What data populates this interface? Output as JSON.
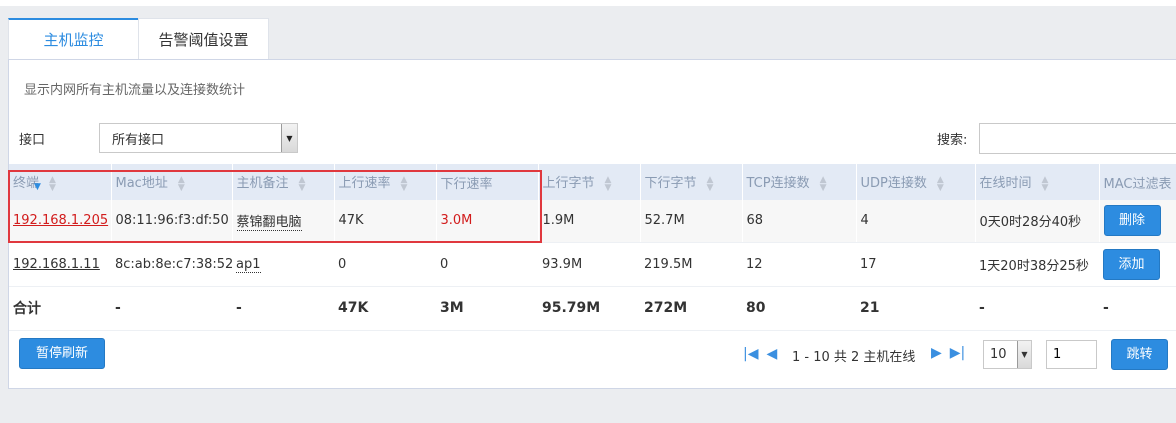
{
  "tabs": [
    {
      "label": "主机监控",
      "active": true
    },
    {
      "label": "告警阈值设置",
      "active": false
    }
  ],
  "description": "显示内网所有主机流量以及连接数统计",
  "filter": {
    "interface_label": "接口",
    "interface_value": "所有接口",
    "search_label": "搜索:",
    "search_value": ""
  },
  "table": {
    "columns": [
      "终端",
      "Mac地址",
      "主机备注",
      "上行速率",
      "下行速率",
      "上行字节",
      "下行字节",
      "TCP连接数",
      "UDP连接数",
      "在线时间",
      "MAC过滤表"
    ],
    "sorted_column": "下行速率",
    "sort_direction": "desc",
    "rows": [
      {
        "terminal": "192.168.1.205",
        "mac": "08:11:96:f3:df:50",
        "note": "蔡锦翻电脑",
        "up_rate": "47K",
        "down_rate": "3.0M",
        "up_bytes": "1.9M",
        "down_bytes": "52.7M",
        "tcp": "68",
        "udp": "4",
        "online": "0天0时28分40秒",
        "action": "删除"
      },
      {
        "terminal": "192.168.1.11",
        "mac": "8c:ab:8e:c7:38:52",
        "note": "ap1",
        "up_rate": "0",
        "down_rate": "0",
        "up_bytes": "93.9M",
        "down_bytes": "219.5M",
        "tcp": "12",
        "udp": "17",
        "online": "1天20时38分25秒",
        "action": "添加"
      }
    ],
    "total": {
      "label": "合计",
      "mac": "-",
      "note": "-",
      "up_rate": "47K",
      "down_rate": "3M",
      "up_bytes": "95.79M",
      "down_bytes": "272M",
      "tcp": "80",
      "udp": "21",
      "online": "-",
      "action": "-"
    }
  },
  "footer": {
    "pause_label": "暂停刷新",
    "pager_text": "1 - 10 共 2 主机在线",
    "page_size": "10",
    "page_number": "1",
    "jump_label": "跳转"
  },
  "colors": {
    "accent": "#2d8ce0",
    "highlight": "#e0383e",
    "alert_text": "#d21c1c"
  }
}
